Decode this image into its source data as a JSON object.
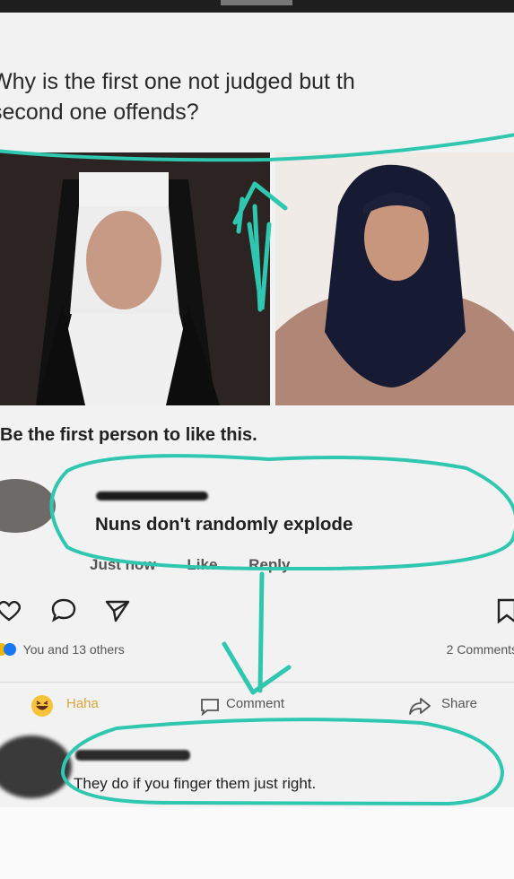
{
  "question": {
    "line1": "Why is the first one not judged but th",
    "line2": "second one offends?"
  },
  "photos": {
    "left_icon": "nun-portrait",
    "right_icon": "hijab-portrait"
  },
  "post": {
    "like_prompt": "Be the first person to like this."
  },
  "comment1": {
    "text": "Nuns don't randomly explode",
    "time": "Just now",
    "like_label": "Like",
    "reply_label": "Reply"
  },
  "reactions": {
    "summary": "You and 13 others",
    "comments_count": "2 Comments"
  },
  "action_bar": {
    "haha_label": "Haha",
    "comment_label": "Comment",
    "share_label": "Share"
  },
  "comment2": {
    "text": "They do if you finger them just right."
  },
  "colors": {
    "annotation": "#2fc7b0",
    "background": "#f2f2f2"
  }
}
